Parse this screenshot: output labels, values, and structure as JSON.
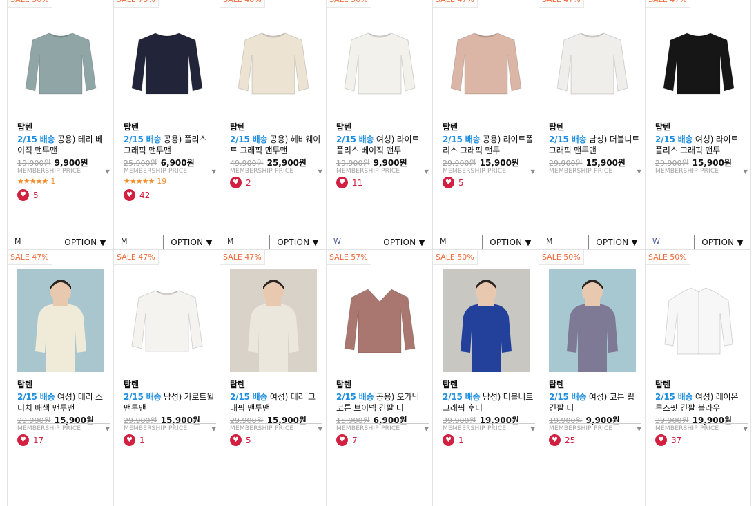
{
  "products_row1": [
    {
      "sale": "SALE 50%",
      "brand": "탑텐",
      "ship": "2/15 배송",
      "name": "공용) 테리 베이직 맨투맨",
      "orig": "19,900원",
      "price": "9,900원",
      "member": "MEMBERSHIP PRICE",
      "stars": "★★★★★",
      "reviews": "1",
      "likes": "5",
      "size": "M",
      "option": "OPTION ▼",
      "color": "#8fa5a6",
      "icon": "sweatshirt-icon"
    },
    {
      "sale": "SALE 73%",
      "brand": "탑텐",
      "ship": "2/15 배송",
      "name": "공용) 폴리스 그래픽 맨투맨",
      "orig": "25,900원",
      "price": "6,900원",
      "member": "MEMBERSHIP PRICE",
      "stars": "★★★★★",
      "reviews": "19",
      "likes": "42",
      "size": "M",
      "option": "OPTION ▼",
      "color": "#22253a",
      "icon": "sweatshirt-icon"
    },
    {
      "sale": "SALE 48%",
      "brand": "탑텐",
      "ship": "2/15 배송",
      "name": "공용) 헤비웨이트 그래픽 맨투맨",
      "orig": "49,900원",
      "price": "25,900원",
      "member": "MEMBERSHIP PRICE",
      "likes": "2",
      "size": "M",
      "option": "OPTION ▼",
      "color": "#ece3d2",
      "icon": "sweatshirt-icon"
    },
    {
      "sale": "SALE 50%",
      "brand": "탑텐",
      "ship": "2/15 배송",
      "name": "여성) 라이트 폴리스 베이직 맨투",
      "orig": "19,900원",
      "price": "9,900원",
      "member": "MEMBERSHIP PRICE",
      "likes": "11",
      "size": "W",
      "option": "OPTION ▼",
      "color": "#f3f1ec",
      "icon": "sweatshirt-icon"
    },
    {
      "sale": "SALE 47%",
      "brand": "탑텐",
      "ship": "2/15 배송",
      "name": "공용) 라이트폴리스 그래픽 맨투",
      "orig": "29,900원",
      "price": "15,900원",
      "member": "MEMBERSHIP PRICE",
      "likes": "5",
      "size": "M",
      "option": "OPTION ▼",
      "color": "#dbb5a6",
      "icon": "sweatshirt-icon"
    },
    {
      "sale": "SALE 47%",
      "brand": "탑텐",
      "ship": "2/15 배송",
      "name": "남성) 더블니트 그래픽 맨투맨",
      "orig": "29,900원",
      "price": "15,900원",
      "member": "MEMBERSHIP PRICE",
      "size": "M",
      "option": "OPTION ▼",
      "color": "#efeeea",
      "icon": "sweatshirt-icon"
    },
    {
      "sale": "SALE 47%",
      "brand": "탑텐",
      "ship": "2/15 배송",
      "name": "여성) 라이트 폴리스 그래픽 맨투",
      "orig": "29,900원",
      "price": "15,900원",
      "member": "MEMBERSHIP PRICE",
      "size": "W",
      "option": "OPTION ▼",
      "color": "#161616",
      "icon": "sweatshirt-icon"
    }
  ],
  "products_row2": [
    {
      "sale": "SALE 47%",
      "brand": "탑텐",
      "ship": "2/15 배송",
      "name": "여성) 테리 스티치 배색 맨투맨",
      "orig": "29,900원",
      "price": "15,900원",
      "member": "MEMBERSHIP PRICE",
      "likes": "17",
      "color": "#f0ead8",
      "icon": "model-photo-icon",
      "bg": "#a9c6cf"
    },
    {
      "sale": "SALE 47%",
      "brand": "탑텐",
      "ship": "2/15 배송",
      "name": "남성) 가로트윌 맨투맨",
      "orig": "29,900원",
      "price": "15,900원",
      "member": "MEMBERSHIP PRICE",
      "likes": "1",
      "color": "#f4f3f0",
      "icon": "sweatshirt-icon"
    },
    {
      "sale": "SALE 47%",
      "brand": "탑텐",
      "ship": "2/15 배송",
      "name": "여성) 테리 그래픽 맨투맨",
      "orig": "29,900원",
      "price": "15,900원",
      "member": "MEMBERSHIP PRICE",
      "likes": "5",
      "color": "#ece7dd",
      "icon": "model-photo-icon",
      "bg": "#d9d2c8"
    },
    {
      "sale": "SALE 57%",
      "brand": "탑텐",
      "ship": "2/15 배송",
      "name": "공용) 오가닉 코튼 브이넥 긴팔 티",
      "orig": "15,900원",
      "price": "6,900원",
      "member": "MEMBERSHIP PRICE",
      "likes": "7",
      "color": "#a9776f",
      "icon": "tshirt-icon"
    },
    {
      "sale": "SALE 50%",
      "brand": "탑텐",
      "ship": "2/15 배송",
      "name": "남성) 더블니트 그래픽 후디",
      "orig": "39,900원",
      "price": "19,900원",
      "member": "MEMBERSHIP PRICE",
      "likes": "1",
      "color": "#23409a",
      "icon": "model-photo-icon",
      "bg": "#c9c7c2"
    },
    {
      "sale": "SALE 50%",
      "brand": "탑텐",
      "ship": "2/15 배송",
      "name": "여성) 코튼 립 긴팔 티",
      "orig": "19,900원",
      "price": "9,900원",
      "member": "MEMBERSHIP PRICE",
      "likes": "25",
      "color": "#7e7a96",
      "icon": "model-photo-icon",
      "bg": "#a7c7d1"
    },
    {
      "sale": "SALE 50%",
      "brand": "탑텐",
      "ship": "2/15 배송",
      "name": "여성) 레이온 루즈핏 긴팔 블라우",
      "orig": "39,900원",
      "price": "19,900원",
      "member": "MEMBERSHIP PRICE",
      "likes": "37",
      "color": "#f7f7f7",
      "icon": "shirt-icon"
    }
  ]
}
